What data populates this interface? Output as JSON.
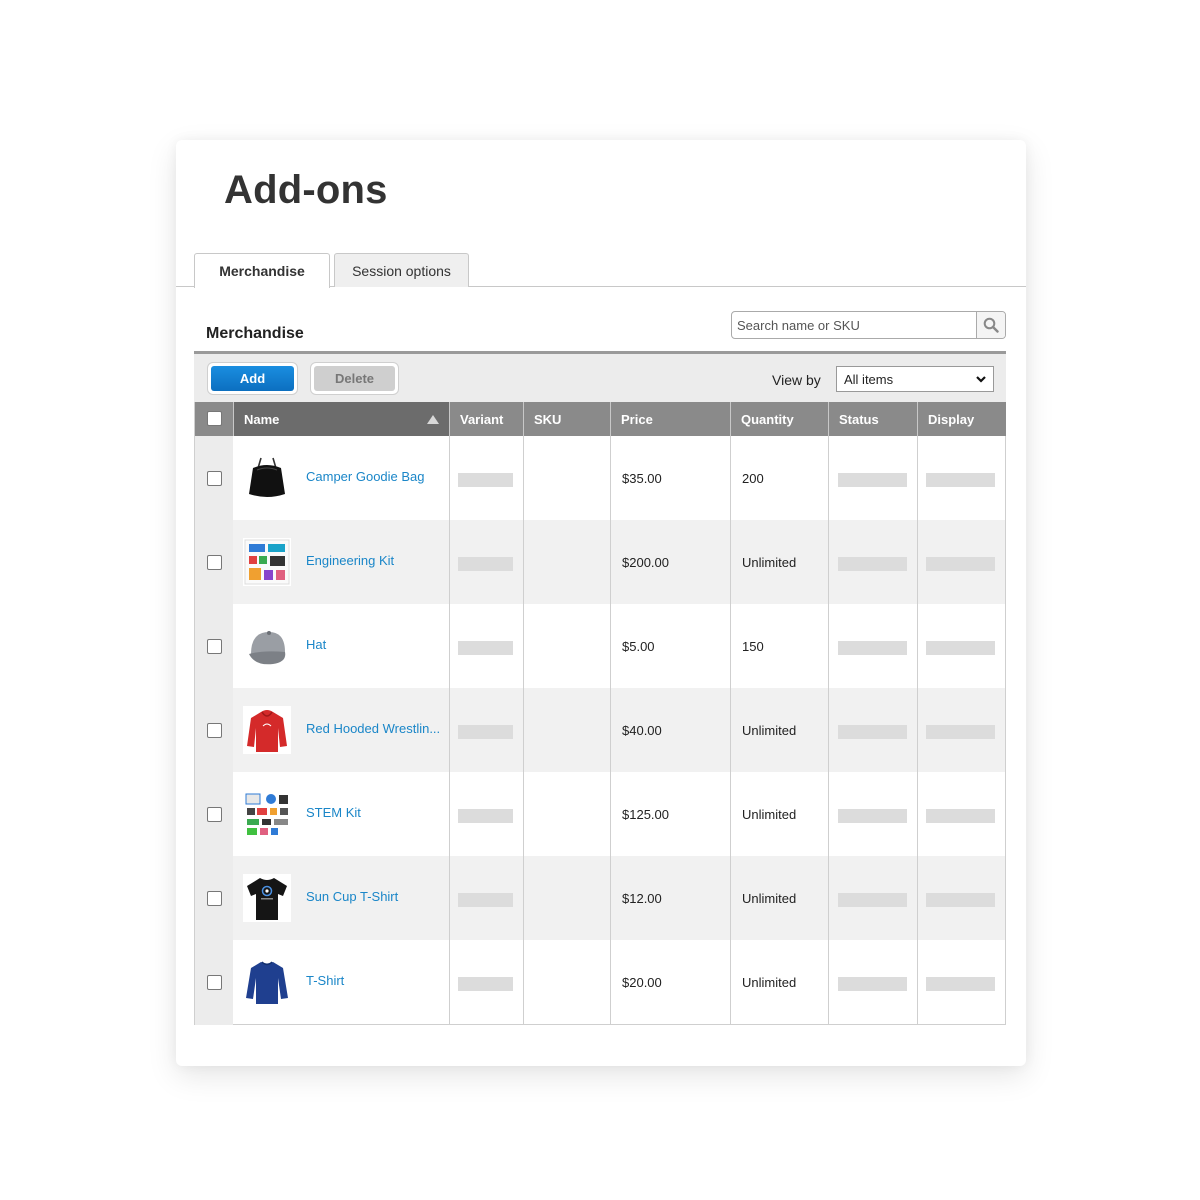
{
  "page": {
    "title": "Add-ons"
  },
  "tabs": [
    {
      "label": "Merchandise",
      "active": true
    },
    {
      "label": "Session options",
      "active": false
    }
  ],
  "section": {
    "title": "Merchandise"
  },
  "search": {
    "placeholder": "Search name or SKU"
  },
  "toolbar": {
    "add_label": "Add",
    "delete_label": "Delete",
    "view_by_label": "View by",
    "view_by_selected": "All items"
  },
  "table": {
    "columns": [
      "Name",
      "Variant",
      "SKU",
      "Price",
      "Quantity",
      "Status",
      "Display"
    ],
    "sort_icon": "sort-ascending-icon",
    "rows": [
      {
        "name": "Camper Goodie Bag",
        "price": "$35.00",
        "quantity": "200",
        "thumb_icon": "drawstring-bag-icon"
      },
      {
        "name": "Engineering Kit",
        "price": "$200.00",
        "quantity": "Unlimited",
        "thumb_icon": "engineering-kit-icon"
      },
      {
        "name": "Hat",
        "price": "$5.00",
        "quantity": "150",
        "thumb_icon": "cap-icon"
      },
      {
        "name": "Red Hooded Wrestlin...",
        "price": "$40.00",
        "quantity": "Unlimited",
        "thumb_icon": "red-hoodie-icon"
      },
      {
        "name": "STEM Kit",
        "price": "$125.00",
        "quantity": "Unlimited",
        "thumb_icon": "stem-kit-icon"
      },
      {
        "name": "Sun Cup T-Shirt",
        "price": "$12.00",
        "quantity": "Unlimited",
        "thumb_icon": "black-tshirt-icon"
      },
      {
        "name": "T-Shirt",
        "price": "$20.00",
        "quantity": "Unlimited",
        "thumb_icon": "blue-longsleeve-icon"
      }
    ]
  },
  "colors": {
    "link": "#1a86c8",
    "add_button": "#0c6fc0",
    "header_bg": "#8a8a8a",
    "header_sorted_bg": "#6c6c6c",
    "row_alt_bg": "#f1f1f1"
  }
}
